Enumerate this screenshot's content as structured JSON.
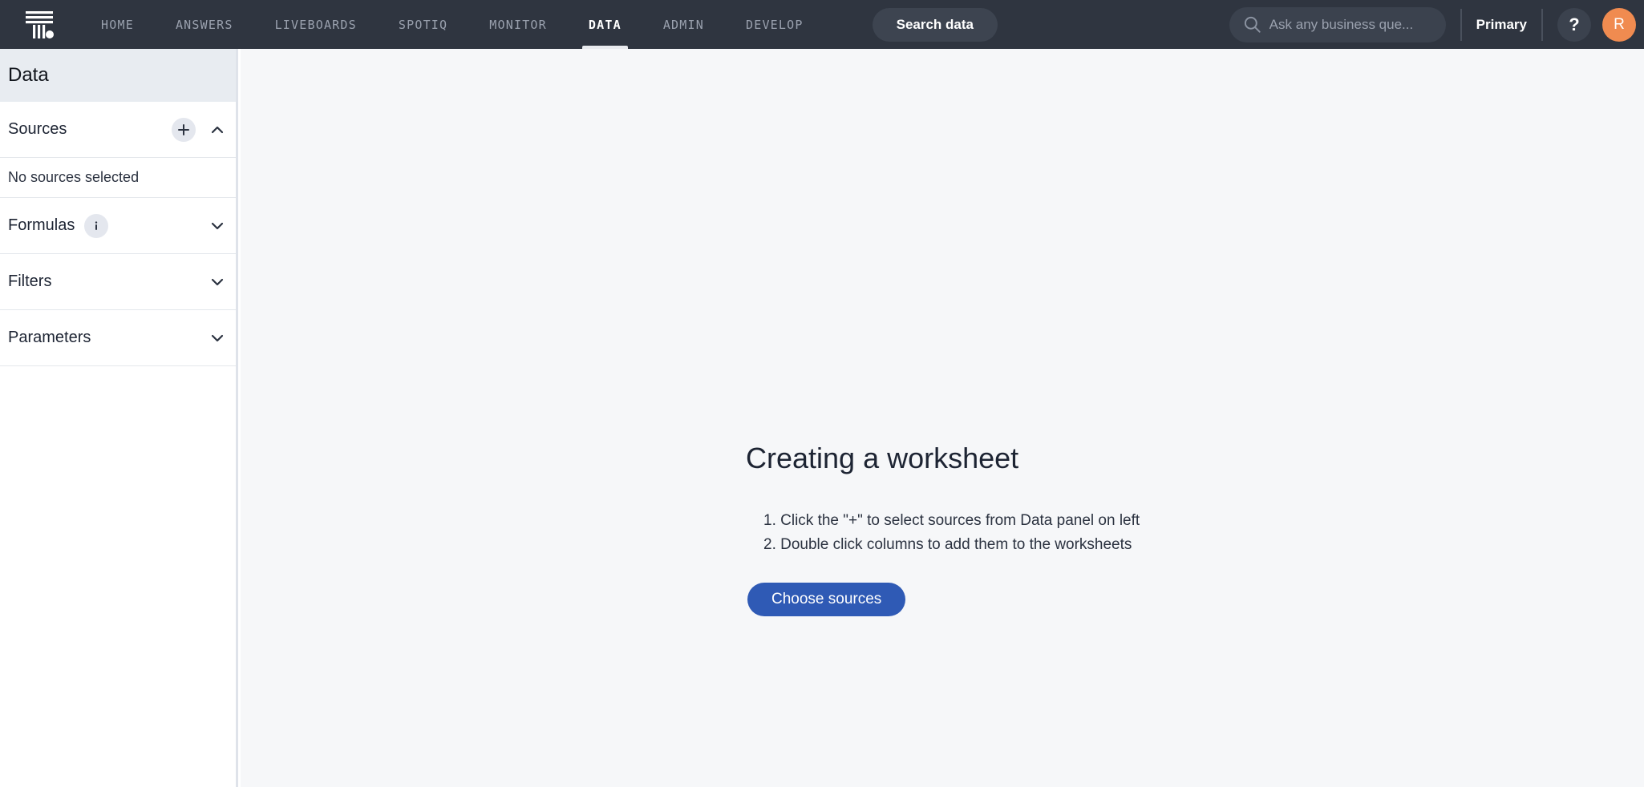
{
  "topbar": {
    "logo_name": "thoughtspot-logo",
    "nav_items": [
      {
        "label": "HOME",
        "active": false
      },
      {
        "label": "ANSWERS",
        "active": false
      },
      {
        "label": "LIVEBOARDS",
        "active": false
      },
      {
        "label": "SPOTIQ",
        "active": false
      },
      {
        "label": "MONITOR",
        "active": false
      },
      {
        "label": "DATA",
        "active": true
      },
      {
        "label": "ADMIN",
        "active": false
      },
      {
        "label": "DEVELOP",
        "active": false
      }
    ],
    "search_data_label": "Search data",
    "ask_placeholder": "Ask any business que...",
    "org_label": "Primary",
    "help_label": "?",
    "avatar_initial": "R",
    "accent_avatar_color": "#f08b50",
    "bar_color": "#2f3540"
  },
  "sidebar": {
    "title": "Data",
    "sections": [
      {
        "label": "Sources",
        "has_add": true,
        "chevron": "up"
      },
      {
        "label": "Formulas",
        "has_info": true,
        "chevron": "down"
      },
      {
        "label": "Filters",
        "chevron": "down"
      },
      {
        "label": "Parameters",
        "chevron": "down"
      }
    ],
    "sources_empty_text": "No sources selected",
    "add_icon_label": "+",
    "info_icon_label": "i"
  },
  "main": {
    "empty_state": {
      "title": "Creating a worksheet",
      "steps": [
        "1. Click the \"+\" to select sources from Data panel on left",
        "2. Double click columns to add them to the worksheets"
      ],
      "cta_label": "Choose sources",
      "cta_color": "#2f5ab5"
    }
  }
}
